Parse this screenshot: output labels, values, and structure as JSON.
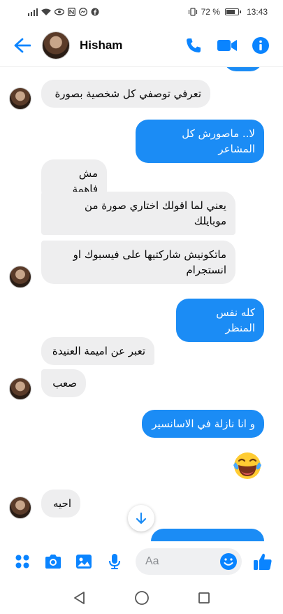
{
  "status_bar": {
    "left_icons": [
      "signal-icon",
      "wifi-icon",
      "eye-icon",
      "nfc-icon",
      "messenger-icon",
      "facebook-icon"
    ],
    "vibrate_icon": "vibrate-icon",
    "battery": "72 %",
    "battery_level_percent": 72,
    "time": "13:43"
  },
  "header": {
    "contact_name": "Hisham",
    "back_icon": "back-arrow-icon",
    "actions": [
      "phone-icon",
      "video-icon",
      "info-icon"
    ],
    "accent_color": "#0a84ff"
  },
  "messages": [
    {
      "from": "them",
      "text": "تعرفي توصفي كل شخصية بصورة"
    },
    {
      "from": "me",
      "text": "لا.. ماصورش كل المشاعر"
    },
    {
      "from": "them",
      "text": "مش فاهمة"
    },
    {
      "from": "them",
      "text": "يعني لما اقولك اختاري صورة من موبايلك"
    },
    {
      "from": "them",
      "text": "ماتكونيش شاركتيها على فيسبوك او انستجرام"
    },
    {
      "from": "me",
      "text": "كله نفس المنظر"
    },
    {
      "from": "them",
      "text": "تعبر عن اميمة العنيدة"
    },
    {
      "from": "them",
      "text": "صعب"
    },
    {
      "from": "me",
      "text": "و انا نازلة في الاسانسير"
    },
    {
      "from": "me",
      "emoji": "laughing-tears-emoji"
    },
    {
      "from": "them",
      "text": "احيه"
    }
  ],
  "composer": {
    "placeholder": "Aa",
    "left_buttons": [
      "apps-icon",
      "camera-icon",
      "gallery-icon",
      "mic-icon"
    ],
    "emoji_icon": "smiley-icon",
    "send_icon": "thumbs-up-icon"
  },
  "nav": [
    "back-triangle-icon",
    "home-circle-icon",
    "recents-square-icon"
  ],
  "colors": {
    "outgoing_bubble": "#1b8cf5",
    "incoming_bubble": "#eeeeef"
  }
}
